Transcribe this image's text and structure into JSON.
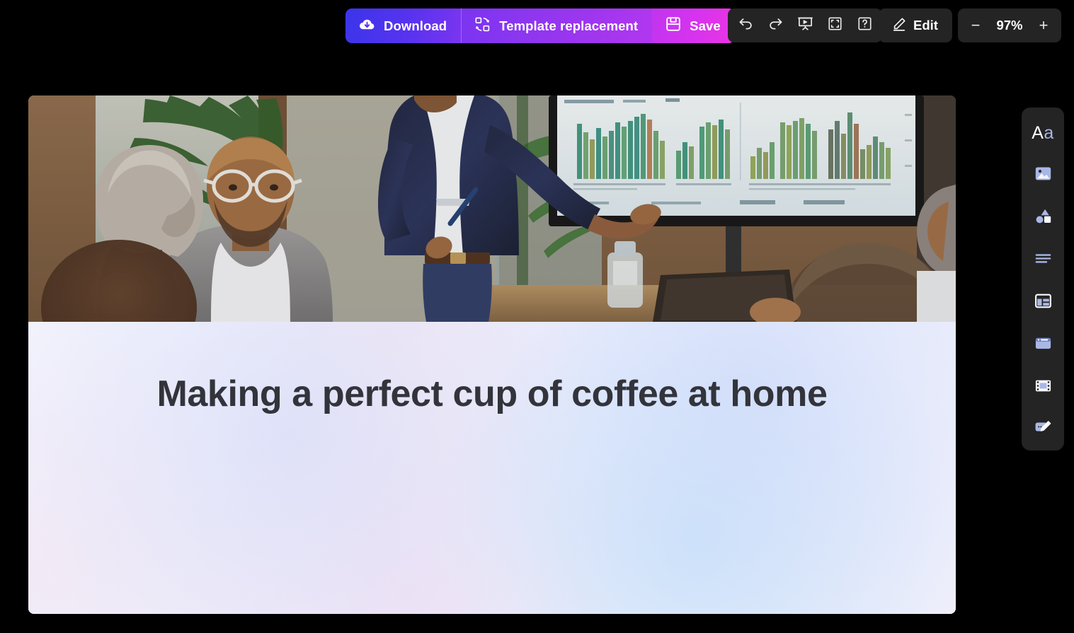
{
  "app": {
    "background_color": "#000000",
    "accent_blue": "#3b35ea",
    "accent_purple": "#9b36ef",
    "accent_magenta": "#d633ef",
    "panel_color": "#242424",
    "icon_blue": "#a9b7e6"
  },
  "toolbar": {
    "download_label": "Download",
    "template_label": "Template replacement",
    "save_label": "Save",
    "edit_label": "Edit",
    "zoom_level": "97%",
    "zoom_out_label": "−",
    "zoom_in_label": "+",
    "icons": [
      {
        "name": "cloud-download-icon"
      },
      {
        "name": "template-swap-icon"
      },
      {
        "name": "floppy-save-icon"
      },
      {
        "name": "undo-icon"
      },
      {
        "name": "redo-icon"
      },
      {
        "name": "present-icon"
      },
      {
        "name": "fullscreen-icon"
      },
      {
        "name": "help-icon"
      },
      {
        "name": "pen-edit-icon"
      }
    ]
  },
  "slide": {
    "title": "Making a perfect cup of coffee at home",
    "photo_alt": "Business presenter in navy suit pointing at a wall screen with green bar charts while colleagues watch in a meeting room",
    "background_color": "#f1f1fc",
    "title_color": "#33343b"
  },
  "sidebar": {
    "items": [
      {
        "name": "sidebar-item-text",
        "icon": "text-aa-icon",
        "label": "Aa"
      },
      {
        "name": "sidebar-item-image",
        "icon": "image-icon",
        "label": "Image"
      },
      {
        "name": "sidebar-item-shapes",
        "icon": "shapes-icon",
        "label": "Shapes"
      },
      {
        "name": "sidebar-item-lines",
        "icon": "lines-icon",
        "label": "Lines"
      },
      {
        "name": "sidebar-item-layout",
        "icon": "layout-icon",
        "label": "Layout"
      },
      {
        "name": "sidebar-item-background",
        "icon": "background-card-icon",
        "label": "Background"
      },
      {
        "name": "sidebar-item-video",
        "icon": "film-icon",
        "label": "Video"
      },
      {
        "name": "sidebar-item-annotate",
        "icon": "annotate-pencil-icon",
        "label": "Annotate"
      }
    ]
  }
}
